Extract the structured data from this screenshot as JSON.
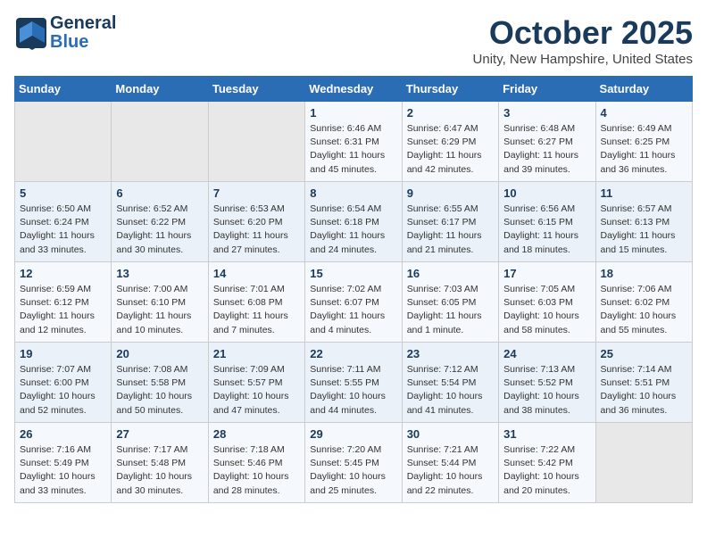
{
  "header": {
    "logo_general": "General",
    "logo_blue": "Blue",
    "month": "October 2025",
    "location": "Unity, New Hampshire, United States"
  },
  "days_of_week": [
    "Sunday",
    "Monday",
    "Tuesday",
    "Wednesday",
    "Thursday",
    "Friday",
    "Saturday"
  ],
  "weeks": [
    [
      {
        "day": "",
        "info": ""
      },
      {
        "day": "",
        "info": ""
      },
      {
        "day": "",
        "info": ""
      },
      {
        "day": "1",
        "info": "Sunrise: 6:46 AM\nSunset: 6:31 PM\nDaylight: 11 hours\nand 45 minutes."
      },
      {
        "day": "2",
        "info": "Sunrise: 6:47 AM\nSunset: 6:29 PM\nDaylight: 11 hours\nand 42 minutes."
      },
      {
        "day": "3",
        "info": "Sunrise: 6:48 AM\nSunset: 6:27 PM\nDaylight: 11 hours\nand 39 minutes."
      },
      {
        "day": "4",
        "info": "Sunrise: 6:49 AM\nSunset: 6:25 PM\nDaylight: 11 hours\nand 36 minutes."
      }
    ],
    [
      {
        "day": "5",
        "info": "Sunrise: 6:50 AM\nSunset: 6:24 PM\nDaylight: 11 hours\nand 33 minutes."
      },
      {
        "day": "6",
        "info": "Sunrise: 6:52 AM\nSunset: 6:22 PM\nDaylight: 11 hours\nand 30 minutes."
      },
      {
        "day": "7",
        "info": "Sunrise: 6:53 AM\nSunset: 6:20 PM\nDaylight: 11 hours\nand 27 minutes."
      },
      {
        "day": "8",
        "info": "Sunrise: 6:54 AM\nSunset: 6:18 PM\nDaylight: 11 hours\nand 24 minutes."
      },
      {
        "day": "9",
        "info": "Sunrise: 6:55 AM\nSunset: 6:17 PM\nDaylight: 11 hours\nand 21 minutes."
      },
      {
        "day": "10",
        "info": "Sunrise: 6:56 AM\nSunset: 6:15 PM\nDaylight: 11 hours\nand 18 minutes."
      },
      {
        "day": "11",
        "info": "Sunrise: 6:57 AM\nSunset: 6:13 PM\nDaylight: 11 hours\nand 15 minutes."
      }
    ],
    [
      {
        "day": "12",
        "info": "Sunrise: 6:59 AM\nSunset: 6:12 PM\nDaylight: 11 hours\nand 12 minutes."
      },
      {
        "day": "13",
        "info": "Sunrise: 7:00 AM\nSunset: 6:10 PM\nDaylight: 11 hours\nand 10 minutes."
      },
      {
        "day": "14",
        "info": "Sunrise: 7:01 AM\nSunset: 6:08 PM\nDaylight: 11 hours\nand 7 minutes."
      },
      {
        "day": "15",
        "info": "Sunrise: 7:02 AM\nSunset: 6:07 PM\nDaylight: 11 hours\nand 4 minutes."
      },
      {
        "day": "16",
        "info": "Sunrise: 7:03 AM\nSunset: 6:05 PM\nDaylight: 11 hours\nand 1 minute."
      },
      {
        "day": "17",
        "info": "Sunrise: 7:05 AM\nSunset: 6:03 PM\nDaylight: 10 hours\nand 58 minutes."
      },
      {
        "day": "18",
        "info": "Sunrise: 7:06 AM\nSunset: 6:02 PM\nDaylight: 10 hours\nand 55 minutes."
      }
    ],
    [
      {
        "day": "19",
        "info": "Sunrise: 7:07 AM\nSunset: 6:00 PM\nDaylight: 10 hours\nand 52 minutes."
      },
      {
        "day": "20",
        "info": "Sunrise: 7:08 AM\nSunset: 5:58 PM\nDaylight: 10 hours\nand 50 minutes."
      },
      {
        "day": "21",
        "info": "Sunrise: 7:09 AM\nSunset: 5:57 PM\nDaylight: 10 hours\nand 47 minutes."
      },
      {
        "day": "22",
        "info": "Sunrise: 7:11 AM\nSunset: 5:55 PM\nDaylight: 10 hours\nand 44 minutes."
      },
      {
        "day": "23",
        "info": "Sunrise: 7:12 AM\nSunset: 5:54 PM\nDaylight: 10 hours\nand 41 minutes."
      },
      {
        "day": "24",
        "info": "Sunrise: 7:13 AM\nSunset: 5:52 PM\nDaylight: 10 hours\nand 38 minutes."
      },
      {
        "day": "25",
        "info": "Sunrise: 7:14 AM\nSunset: 5:51 PM\nDaylight: 10 hours\nand 36 minutes."
      }
    ],
    [
      {
        "day": "26",
        "info": "Sunrise: 7:16 AM\nSunset: 5:49 PM\nDaylight: 10 hours\nand 33 minutes."
      },
      {
        "day": "27",
        "info": "Sunrise: 7:17 AM\nSunset: 5:48 PM\nDaylight: 10 hours\nand 30 minutes."
      },
      {
        "day": "28",
        "info": "Sunrise: 7:18 AM\nSunset: 5:46 PM\nDaylight: 10 hours\nand 28 minutes."
      },
      {
        "day": "29",
        "info": "Sunrise: 7:20 AM\nSunset: 5:45 PM\nDaylight: 10 hours\nand 25 minutes."
      },
      {
        "day": "30",
        "info": "Sunrise: 7:21 AM\nSunset: 5:44 PM\nDaylight: 10 hours\nand 22 minutes."
      },
      {
        "day": "31",
        "info": "Sunrise: 7:22 AM\nSunset: 5:42 PM\nDaylight: 10 hours\nand 20 minutes."
      },
      {
        "day": "",
        "info": ""
      }
    ]
  ]
}
